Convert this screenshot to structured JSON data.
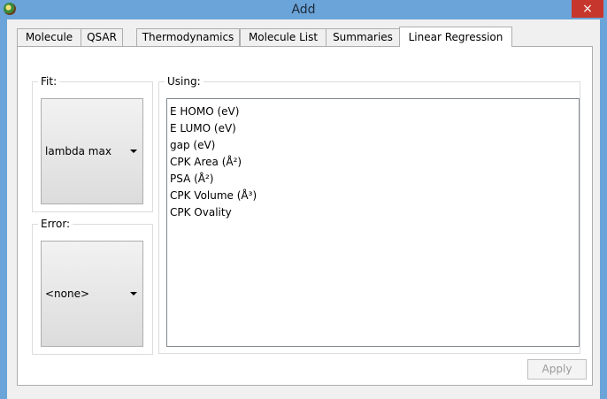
{
  "window": {
    "title": "Add",
    "close_glyph": "×",
    "app_icon": "app-icon"
  },
  "tabs": [
    {
      "label": "Molecule",
      "active": false
    },
    {
      "label": "QSAR",
      "active": false
    },
    {
      "label": "Thermodynamics",
      "active": false
    },
    {
      "label": "Molecule List",
      "active": false
    },
    {
      "label": "Summaries",
      "active": false
    },
    {
      "label": "Linear Regression",
      "active": true
    }
  ],
  "fit": {
    "label": "Fit:",
    "selected": "lambda max"
  },
  "error": {
    "label": "Error:",
    "selected": "<none>"
  },
  "using": {
    "label": "Using:",
    "items": [
      "E HOMO (eV)",
      "E LUMO (eV)",
      "gap (eV)",
      "CPK Area (Å²)",
      "PSA (Å²)",
      "CPK Volume (Å³)",
      "CPK Ovality"
    ]
  },
  "apply_label": "Apply",
  "colors": {
    "titlebar": "#6ba4d9",
    "close": "#c7362d",
    "disabled_text": "#9a9a9a"
  }
}
